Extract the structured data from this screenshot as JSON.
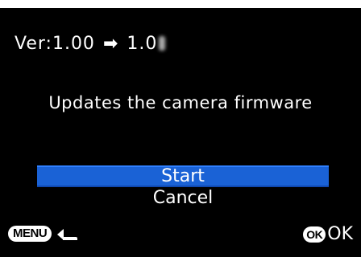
{
  "version": {
    "label": "Ver:1.00",
    "arrow": "➡",
    "target": "1.0"
  },
  "message": "Updates the camera firmware",
  "menu": {
    "items": [
      {
        "label": "Start",
        "selected": true
      },
      {
        "label": "Cancel",
        "selected": false
      }
    ]
  },
  "footer": {
    "menu_badge": "MENU",
    "ok_badge": "OK",
    "ok_label": "OK"
  },
  "colors": {
    "background": "#000000",
    "text": "#ffffff",
    "selection": "#1a62d6"
  },
  "icons": {
    "back": "back-arrow-icon"
  }
}
